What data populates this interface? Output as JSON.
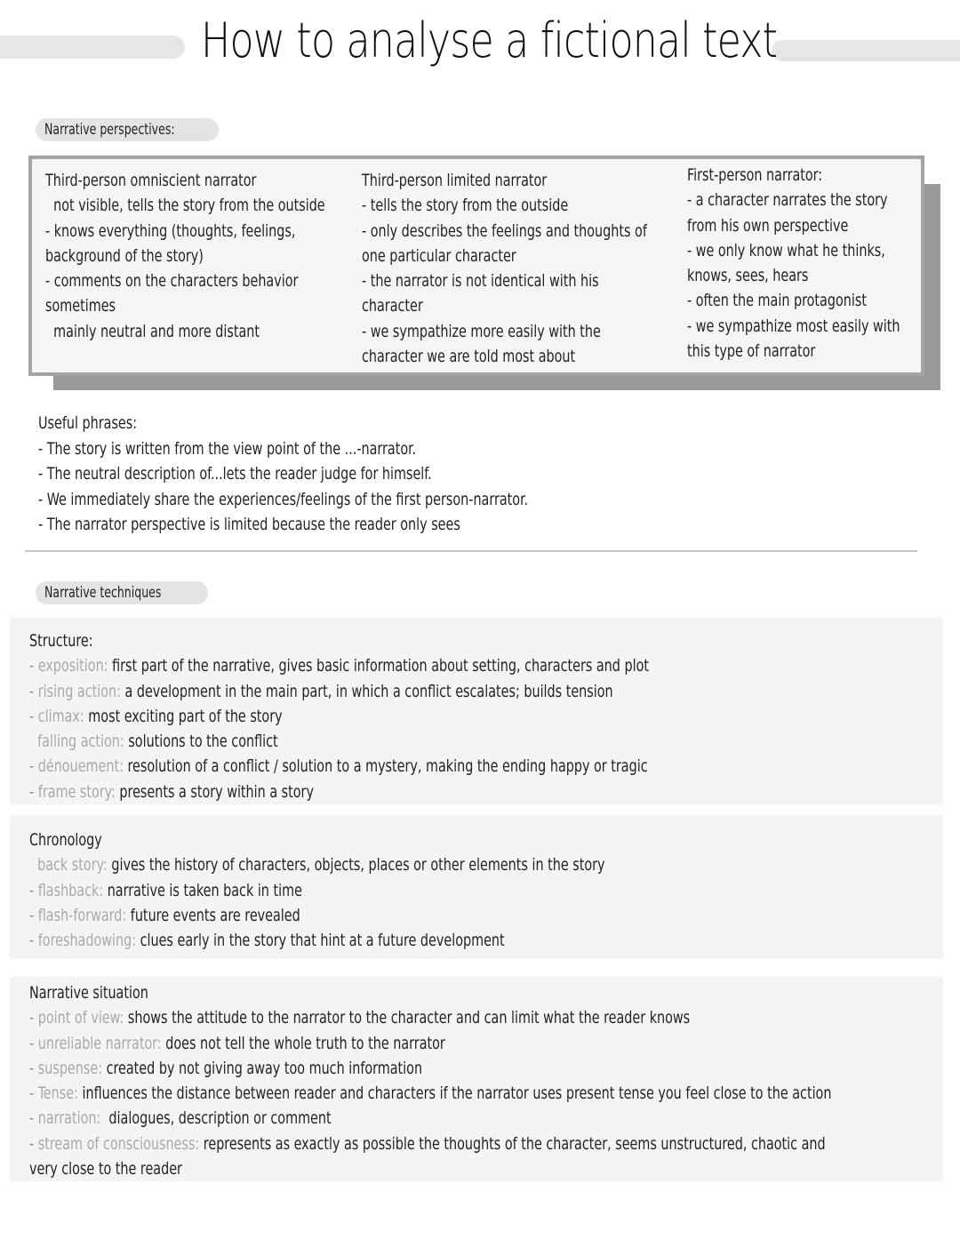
{
  "title": "How to analyse a fictional text",
  "perspectives": {
    "label": "Narrative perspectives:",
    "columns": [
      {
        "heading": "Third-person omniscient narrator",
        "lines": [
          "  not visible, tells the story from the outside",
          "- knows everything (thoughts, feelings,",
          "background of the story)",
          "- comments on the characters behavior",
          "sometimes",
          "  mainly neutral and more distant"
        ]
      },
      {
        "heading": "Third-person limited narrator",
        "lines": [
          "- tells the story from the outside",
          "- only describes the feelings and thoughts of",
          "one particular character",
          "- the narrator is not identical with his",
          "character",
          "- we sympathize more easily with the",
          "character we are told most about"
        ]
      },
      {
        "heading": "First-person narrator:",
        "lines": [
          "- a character narrates the story",
          "from his own perspective",
          "- we only know what he thinks,",
          "knows, sees, hears",
          "- often the main protagonist",
          "- we sympathize most easily with",
          "this type of narrator"
        ]
      }
    ]
  },
  "phrases": {
    "heading": "Useful phrases:",
    "items": [
      "- The story is written from the view point of the ...-narrator.",
      "- The neutral description of...lets the reader judge for himself.",
      "- We immediately share the experiences/feelings of the first person-narrator.",
      "- The narrator perspective is limited because the reader only sees"
    ]
  },
  "techniques": {
    "label": "Narrative techniques",
    "structure": {
      "heading": "Structure:",
      "items": [
        {
          "prefix": "- ",
          "term": "exposition:",
          "text": " first part of the narrative, gives basic information about setting, characters and plot"
        },
        {
          "prefix": "- ",
          "term": "rising action:",
          "text": " a development in the main part, in which a conflict escalates; builds tension"
        },
        {
          "prefix": "- ",
          "term": "climax:",
          "text": " most exciting part of the story"
        },
        {
          "prefix": "  ",
          "term": "falling action:",
          "text": " solutions to the conflict"
        },
        {
          "prefix": "- ",
          "term": "dénouement:",
          "text": " resolution of a conflict / solution to a mystery, making the ending happy or tragic"
        },
        {
          "prefix": "- ",
          "term": "frame story:",
          "text": " presents a story within a story"
        }
      ]
    },
    "chronology": {
      "heading": "Chronology",
      "items": [
        {
          "prefix": "  ",
          "term": "back story:",
          "text": " gives the history of characters, objects, places or other elements in the story"
        },
        {
          "prefix": "- ",
          "term": "flashback:",
          "text": " narrative is taken back in time"
        },
        {
          "prefix": "- ",
          "term": "flash-forward:",
          "text": " future events are revealed"
        },
        {
          "prefix": "- ",
          "term": "foreshadowing:",
          "text": " clues early in the story that hint at a future development"
        }
      ]
    },
    "situation": {
      "heading": "Narrative situation",
      "items": [
        {
          "prefix": "- ",
          "term": "point of view:",
          "text": " shows the attitude to the narrator to the character and can limit what the reader knows"
        },
        {
          "prefix": "- ",
          "term": "unreliable narrator:",
          "text": " does not tell the whole truth to the narrator"
        },
        {
          "prefix": "- ",
          "term": "suspense:",
          "text": " created by not giving away too much information"
        },
        {
          "prefix": "- ",
          "term": "Tense:",
          "text": " influences the distance between reader and characters if the narrator uses present tense you feel close to the action"
        },
        {
          "prefix": "- ",
          "term": "narration:",
          "text": "  dialogues, description or comment"
        },
        {
          "prefix": "- ",
          "term": "stream of consciousness:",
          "text": " represents as exactly as possible the thoughts of the character, seems unstructured, chaotic and"
        }
      ],
      "continuation": "very close to the reader"
    }
  }
}
